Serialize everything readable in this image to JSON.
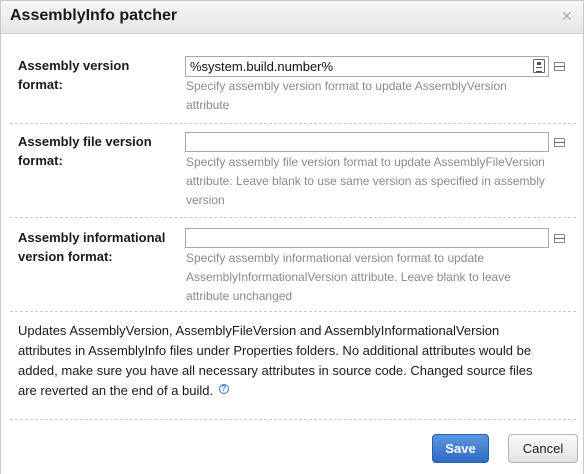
{
  "dialog": {
    "title": "AssemblyInfo patcher",
    "close_glyph": "✕"
  },
  "fields": [
    {
      "label_line1": "Assembly version",
      "label_line2": "format:",
      "value": "%system.build.number%",
      "hint_line1": "Specify assembly version format to update AssemblyVersion",
      "hint_line2": "attribute",
      "hint_line3": ""
    },
    {
      "label_line1": "Assembly file version",
      "label_line2": "format:",
      "value": "",
      "hint_line1": "Specify assembly file version format to update AssemblyFileVersion",
      "hint_line2": "attribute. Leave blank to use same version as specified in assembly",
      "hint_line3": "version"
    },
    {
      "label_line1": "Assembly informational",
      "label_line2": "version format:",
      "value": "",
      "hint_line1": "Specify assembly informational version format to update",
      "hint_line2": "AssemblyInformationalVersion attribute. Leave blank to leave",
      "hint_line3": "attribute unchanged"
    }
  ],
  "description": {
    "line1": "Updates AssemblyVersion, AssemblyFileVersion and AssemblyInformationalVersion",
    "line2": "attributes in AssemblyInfo files under Properties folders. No additional attributes would be",
    "line3": "added, make sure you have all necessary attributes in source code. Changed source files",
    "line4": "are reverted an the end of a build.",
    "help_glyph": "?"
  },
  "buttons": {
    "save_label": "Save",
    "cancel_label": "Cancel"
  },
  "icons": {
    "picker": "parameter-picker-icon",
    "properties": "properties-list-icon",
    "help": "help-icon",
    "close": "close-icon"
  },
  "colors": {
    "save_button": "#2d6bc2",
    "hint_text": "#8a8a8a",
    "help_icon": "#3a7bd5"
  }
}
